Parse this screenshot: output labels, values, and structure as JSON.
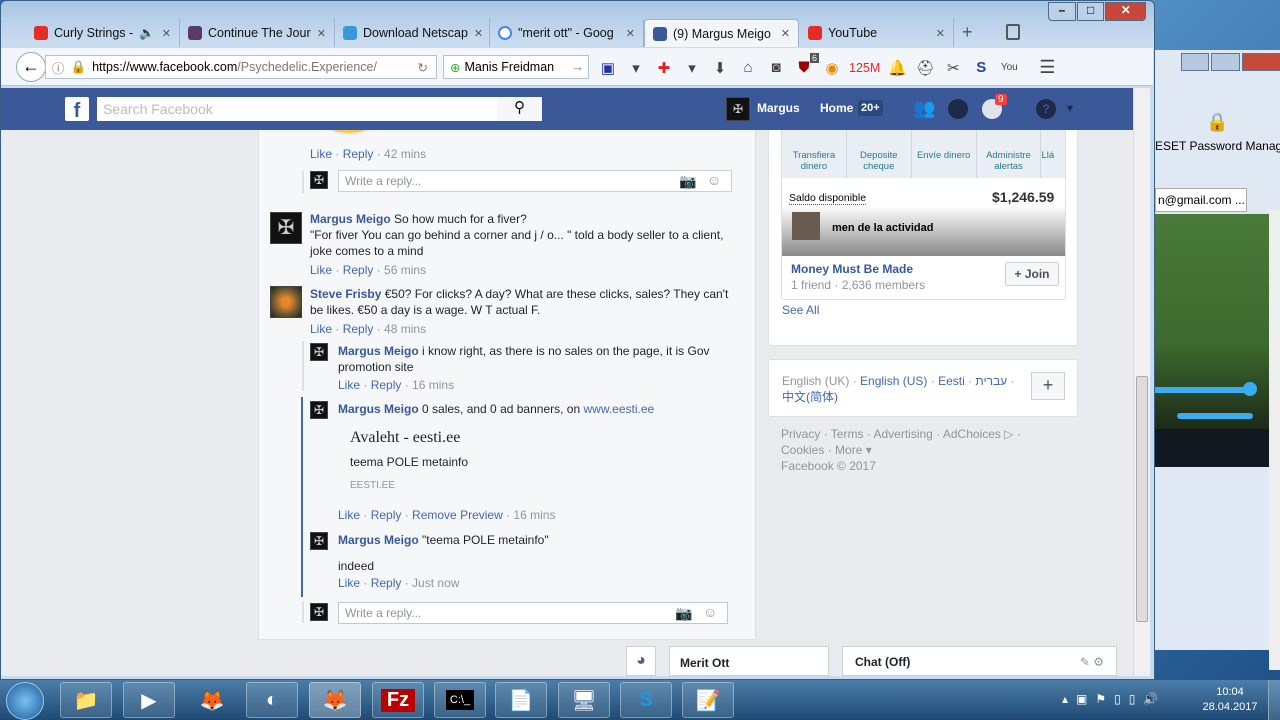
{
  "browser": {
    "tabs": [
      {
        "label": "Curly Strings -",
        "icon": "youtube-icon",
        "color": "#e52d27",
        "audio": "speaker-icon"
      },
      {
        "label": "Continue The Jour",
        "icon": "thumbnail-icon",
        "color": "#5a3a6a"
      },
      {
        "label": "Download Netscap",
        "icon": "netscape-icon",
        "color": "#3a9ad9"
      },
      {
        "label": "\"merit ott\" - Goog",
        "icon": "google-icon",
        "color": "#4285f4"
      },
      {
        "label": "(9) Margus Meigo",
        "icon": "facebook-icon",
        "color": "#3b5998",
        "active": true
      },
      {
        "label": "YouTube",
        "icon": "youtube-icon",
        "color": "#e52d27"
      }
    ],
    "url_domain": "https://www.facebook.com",
    "url_path": "/Psychedelic.Experience/",
    "search_value": "Manis Freidman",
    "badge_count": "6",
    "memory": "125M"
  },
  "fb": {
    "search_placeholder": "Search Facebook",
    "user": "Margus",
    "home": "Home",
    "home_badge": "20+",
    "notif_badge": "9",
    "colors": {
      "brand": "#3b5998",
      "link": "#365899"
    }
  },
  "comments": {
    "c0": {
      "like": "Like",
      "reply": "Reply",
      "time": "42 mins"
    },
    "reply_placeholder": "Write a reply...",
    "c1": {
      "name": "Margus Meigo",
      "text": "So how much for a fiver?",
      "text2": "\"For fiver You can go behind a corner and j / o... \" told a body seller to a client, joke comes to a mind",
      "like": "Like",
      "reply": "Reply",
      "time": "56 mins"
    },
    "c2": {
      "name": "Steve Frisby",
      "text": "€50? For clicks? A day? What are these clicks, sales? They can't be likes. €50 a day is a wage. W T actual F.",
      "like": "Like",
      "reply": "Reply",
      "time": "48 mins"
    },
    "r1": {
      "name": "Margus Meigo",
      "text": "i know right, as there is no sales on the page, it is Gov promotion site",
      "like": "Like",
      "reply": "Reply",
      "time": "16 mins"
    },
    "r2": {
      "name": "Margus Meigo",
      "text": "0 sales, and 0 ad banners, on",
      "link": "www.eesti.ee",
      "preview_title": "Avaleht - eesti.ee",
      "preview_desc": "teema POLE metainfo",
      "preview_domain": "EESTI.EE",
      "like": "Like",
      "reply": "Reply",
      "remove": "Remove Preview",
      "time": "16 mins"
    },
    "r3": {
      "name": "Margus Meigo",
      "text": "\"teema POLE metainfo\"",
      "text2": "indeed",
      "like": "Like",
      "reply": "Reply",
      "time": "Just now"
    }
  },
  "sidebar": {
    "bank_actions": [
      "Transfiera dinero",
      "Deposite cheque",
      "Envíe dinero",
      "Administre alertas",
      "Llá"
    ],
    "balance_label": "Saldo disponible",
    "balance": "$1,246.59",
    "activity": "men de la actividad",
    "group_name": "Money Must Be Made",
    "group_meta": "1 friend · 2,636 members",
    "join": "+ Join",
    "see_all": "See All",
    "languages": [
      "English (UK)",
      "English (US)",
      "Eesti",
      "עברית",
      "中文(简体)"
    ],
    "footer": [
      "Privacy",
      "Terms",
      "Advertising",
      "AdChoices",
      "Cookies",
      "More",
      "Facebook © 2017"
    ]
  },
  "chat": {
    "contact": "Merit Ott",
    "status": "Chat (Off)"
  },
  "bgwin": {
    "title": "ESET Password Manager",
    "tab": "n@gmail.com ..."
  },
  "taskbar": {
    "time": "10:04",
    "date": "28.04.2017"
  }
}
